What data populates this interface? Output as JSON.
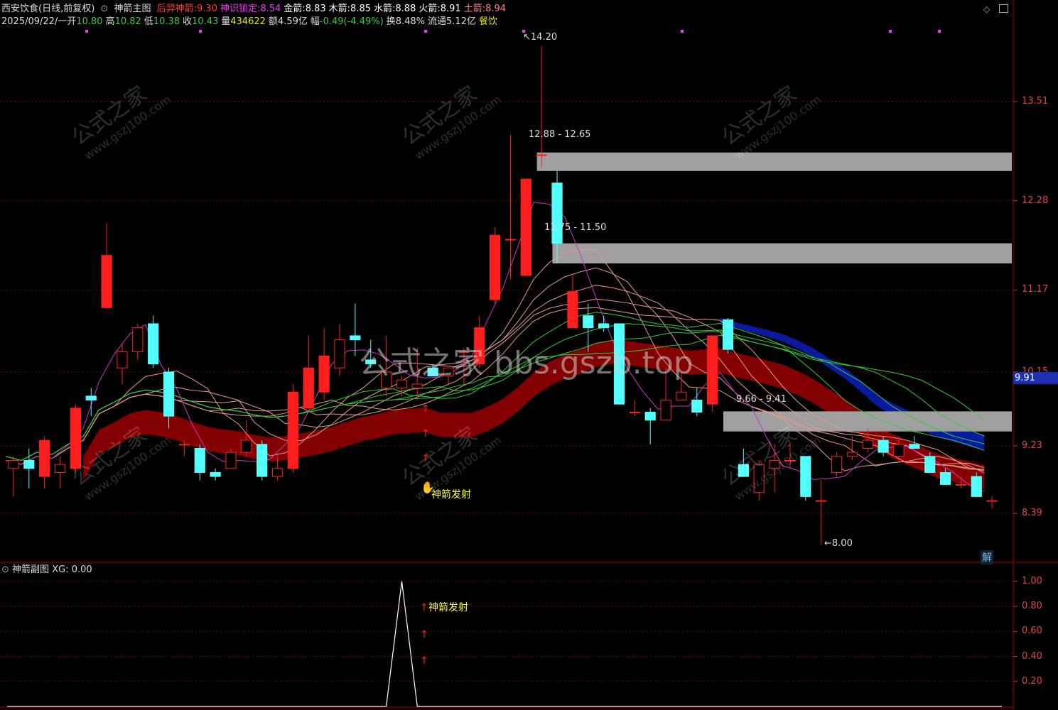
{
  "header": {
    "title": "西安饮食(日线,前复权)",
    "indicator_name": "神箭主图",
    "items": [
      {
        "label": "后羿神箭:",
        "value": "9.30",
        "color": "#ff3b3b"
      },
      {
        "label": "神识锁定:",
        "value": "8.54",
        "color": "#ff33ff"
      },
      {
        "label": "金箭:",
        "value": "8.83",
        "color": "#ffffff"
      },
      {
        "label": "木箭:",
        "value": "8.85",
        "color": "#ffffff"
      },
      {
        "label": "水箭:",
        "value": "8.88",
        "color": "#ffffff"
      },
      {
        "label": "火箭:",
        "value": "8.91",
        "color": "#ffffff"
      },
      {
        "label": "土箭:",
        "value": "8.94",
        "color": "#ff8080"
      }
    ]
  },
  "quote": {
    "date": "2025/09/22/一",
    "open_label": "开",
    "open": "10.80",
    "high_label": "高",
    "high": "10.82",
    "low_label": "低",
    "low": "10.38",
    "close_label": "收",
    "close": "10.43",
    "vol_label": "量",
    "vol": "434622",
    "amount_label": "额",
    "amount": "4.59亿",
    "chg_label": "幅",
    "chg": "-0.49(-4.49%)",
    "turnover_label": "换",
    "turnover": "8.48%",
    "float_label": "流通",
    "float": "5.12亿",
    "sector": "餐饮"
  },
  "main_axis": {
    "ticks": [
      "13.51",
      "12.28",
      "11.17",
      "10.15",
      "9.23",
      "8.39"
    ],
    "current_price": "9.91"
  },
  "annotations": {
    "high_label": "14.20",
    "low_label": "8.00",
    "zone1": "12.88 - 12.65",
    "zone2": "11.75 - 11.50",
    "zone3": "9.66 - 9.41",
    "signal": "神箭发射"
  },
  "watermark": {
    "center": "公式之家 bbs.gszb.top",
    "small_cn": "公式之家",
    "small_en": "www.gszj100.com"
  },
  "sub_panel": {
    "title": "神箭副图",
    "xg_label": "XG:",
    "xg_value": "0.00",
    "ticks": [
      "1.00",
      "0.80",
      "0.60",
      "0.40",
      "0.20"
    ],
    "signal": "神箭发射"
  },
  "misc": {
    "jie_label": "解"
  },
  "colors": {
    "up": "#ff1e1e",
    "down": "#54ffff",
    "grid": "#7a0000",
    "ribbon": "#8b0000",
    "zone": "#a0a0a0",
    "blue_ribbon": "#0a1aa0"
  },
  "chart_data": {
    "type": "candlestick",
    "candles": [
      {
        "o": 8.95,
        "h": 9.1,
        "l": 8.6,
        "c": 9.05
      },
      {
        "o": 9.05,
        "h": 9.2,
        "l": 8.7,
        "c": 8.95
      },
      {
        "o": 8.85,
        "h": 9.35,
        "l": 8.7,
        "c": 9.3
      },
      {
        "o": 8.9,
        "h": 9.1,
        "l": 8.7,
        "c": 9.0
      },
      {
        "o": 8.95,
        "h": 9.75,
        "l": 8.9,
        "c": 9.7
      },
      {
        "o": 9.85,
        "h": 9.95,
        "l": 9.6,
        "c": 9.8
      },
      {
        "o": 10.95,
        "h": 12.0,
        "l": 10.95,
        "c": 11.6
      },
      {
        "o": 10.2,
        "h": 10.5,
        "l": 10.0,
        "c": 10.4
      },
      {
        "o": 10.4,
        "h": 10.75,
        "l": 10.3,
        "c": 10.7
      },
      {
        "o": 10.75,
        "h": 10.85,
        "l": 10.2,
        "c": 10.25
      },
      {
        "o": 10.15,
        "h": 10.2,
        "l": 9.45,
        "c": 9.6
      },
      {
        "o": 9.25,
        "h": 9.3,
        "l": 9.1,
        "c": 9.25
      },
      {
        "o": 9.2,
        "h": 9.25,
        "l": 8.8,
        "c": 8.9
      },
      {
        "o": 8.9,
        "h": 8.95,
        "l": 8.8,
        "c": 8.85
      },
      {
        "o": 8.95,
        "h": 9.2,
        "l": 8.95,
        "c": 9.15
      },
      {
        "o": 9.15,
        "h": 9.55,
        "l": 9.1,
        "c": 9.3
      },
      {
        "o": 9.25,
        "h": 9.3,
        "l": 8.8,
        "c": 8.85
      },
      {
        "o": 8.85,
        "h": 9.1,
        "l": 8.8,
        "c": 8.95
      },
      {
        "o": 8.95,
        "h": 10.0,
        "l": 8.9,
        "c": 9.9
      },
      {
        "o": 9.7,
        "h": 10.6,
        "l": 9.7,
        "c": 10.2
      },
      {
        "o": 9.9,
        "h": 10.7,
        "l": 9.8,
        "c": 10.35
      },
      {
        "o": 10.2,
        "h": 10.75,
        "l": 10.1,
        "c": 10.55
      },
      {
        "o": 10.6,
        "h": 11.0,
        "l": 10.35,
        "c": 10.55
      },
      {
        "o": 10.3,
        "h": 10.55,
        "l": 10.2,
        "c": 10.25
      },
      {
        "o": 9.95,
        "h": 10.6,
        "l": 9.85,
        "c": 10.15
      },
      {
        "o": 9.95,
        "h": 10.1,
        "l": 9.85,
        "c": 10.05
      },
      {
        "o": 9.95,
        "h": 10.45,
        "l": 9.8,
        "c": 10.0
      },
      {
        "o": 10.2,
        "h": 10.25,
        "l": 10.1,
        "c": 10.1
      },
      {
        "o": 10.1,
        "h": 10.2,
        "l": 10.0,
        "c": 10.2
      },
      {
        "o": 10.4,
        "h": 10.45,
        "l": 10.0,
        "c": 10.4
      },
      {
        "o": 10.25,
        "h": 10.85,
        "l": 10.2,
        "c": 10.7
      },
      {
        "o": 11.05,
        "h": 11.95,
        "l": 11.0,
        "c": 11.85
      },
      {
        "o": 11.8,
        "h": 13.1,
        "l": 11.3,
        "c": 11.8
      },
      {
        "o": 11.35,
        "h": 12.55,
        "l": 11.35,
        "c": 12.55
      },
      {
        "o": 12.85,
        "h": 14.2,
        "l": 12.7,
        "c": 12.85
      },
      {
        "o": 12.5,
        "h": 12.65,
        "l": 11.5,
        "c": 11.75
      },
      {
        "o": 10.7,
        "h": 11.35,
        "l": 10.7,
        "c": 11.15
      },
      {
        "o": 10.85,
        "h": 11.0,
        "l": 10.4,
        "c": 10.7
      },
      {
        "o": 10.75,
        "h": 10.85,
        "l": 10.65,
        "c": 10.7
      },
      {
        "o": 10.75,
        "h": 10.75,
        "l": 9.75,
        "c": 9.75
      },
      {
        "o": 9.65,
        "h": 9.8,
        "l": 9.6,
        "c": 9.65
      },
      {
        "o": 9.65,
        "h": 9.7,
        "l": 9.25,
        "c": 9.55
      },
      {
        "o": 9.55,
        "h": 10.2,
        "l": 9.55,
        "c": 9.8
      },
      {
        "o": 9.8,
        "h": 10.15,
        "l": 9.8,
        "c": 9.9
      },
      {
        "o": 9.8,
        "h": 9.95,
        "l": 9.6,
        "c": 9.65
      },
      {
        "o": 9.75,
        "h": 10.6,
        "l": 9.65,
        "c": 10.6
      },
      {
        "o": 10.8,
        "h": 10.82,
        "l": 10.38,
        "c": 10.43
      },
      {
        "o": 9.0,
        "h": 9.2,
        "l": 8.85,
        "c": 8.85
      },
      {
        "o": 8.65,
        "h": 9.05,
        "l": 8.55,
        "c": 9.0
      },
      {
        "o": 8.95,
        "h": 9.25,
        "l": 8.65,
        "c": 9.05
      },
      {
        "o": 9.05,
        "h": 9.25,
        "l": 8.95,
        "c": 9.05
      },
      {
        "o": 9.1,
        "h": 9.1,
        "l": 8.55,
        "c": 8.6
      },
      {
        "o": 8.55,
        "h": 8.8,
        "l": 8.0,
        "c": 8.55
      },
      {
        "o": 8.9,
        "h": 9.15,
        "l": 8.85,
        "c": 9.1
      },
      {
        "o": 9.1,
        "h": 9.35,
        "l": 9.05,
        "c": 9.15
      },
      {
        "o": 9.2,
        "h": 9.45,
        "l": 9.15,
        "c": 9.3
      },
      {
        "o": 9.3,
        "h": 9.35,
        "l": 9.1,
        "c": 9.15
      },
      {
        "o": 9.1,
        "h": 9.35,
        "l": 9.05,
        "c": 9.25
      },
      {
        "o": 9.25,
        "h": 9.35,
        "l": 9.2,
        "c": 9.2
      },
      {
        "o": 9.1,
        "h": 9.15,
        "l": 8.9,
        "c": 8.9
      },
      {
        "o": 8.9,
        "h": 8.95,
        "l": 8.75,
        "c": 8.75
      },
      {
        "o": 8.75,
        "h": 8.85,
        "l": 8.7,
        "c": 8.75
      },
      {
        "o": 8.85,
        "h": 8.9,
        "l": 8.6,
        "c": 8.6
      },
      {
        "o": 8.55,
        "h": 8.6,
        "l": 8.45,
        "c": 8.55
      }
    ],
    "ylim": [
      7.8,
      14.6
    ],
    "sub_ylim": [
      0,
      1.05
    ],
    "xg_signal_index": 25
  }
}
